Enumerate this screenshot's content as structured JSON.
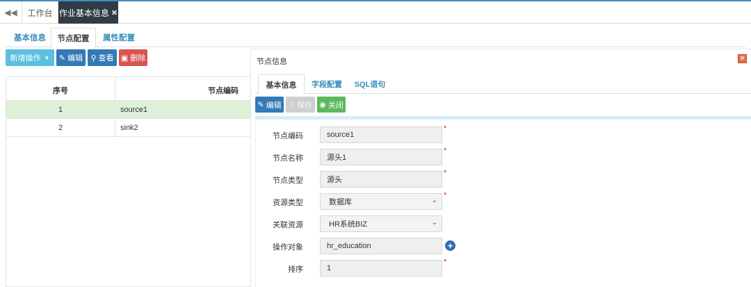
{
  "topbar": {
    "tabs": [
      {
        "label": "工作台"
      },
      {
        "label": "作业基本信息"
      }
    ]
  },
  "subnav": {
    "tabs": [
      {
        "label": "基本信息"
      },
      {
        "label": "节点配置"
      },
      {
        "label": "属性配置"
      }
    ],
    "active": "节点配置"
  },
  "toolbar": {
    "add_label": "新增操作",
    "edit_label": "编辑",
    "view_label": "查看",
    "delete_label": "删除"
  },
  "node_table": {
    "columns": [
      "序号",
      "节点编码"
    ],
    "rows": [
      {
        "index": "1",
        "code": "source1",
        "selected": true
      },
      {
        "index": "2",
        "code": "sink2",
        "selected": false
      }
    ]
  },
  "panel": {
    "title": "节点信息",
    "tabs": [
      {
        "label": "基本信息"
      },
      {
        "label": "字段配置"
      },
      {
        "label": "SQL语句"
      }
    ],
    "buttons": {
      "edit": "编辑",
      "save": "保存",
      "close": "关闭"
    },
    "form": {
      "node_code": {
        "label": "节点编码",
        "value": "source1",
        "required": true
      },
      "node_name": {
        "label": "节点名称",
        "value": "源头1",
        "required": true
      },
      "node_type": {
        "label": "节点类型",
        "value": "源头",
        "required": true
      },
      "resource_type": {
        "label": "资源类型",
        "value": "数据库",
        "required": true
      },
      "linked_resource": {
        "label": "关联资源",
        "value": "HR系统BIZ",
        "required": false
      },
      "operation_target": {
        "label": "操作对象",
        "value": "hr_education",
        "required": false
      },
      "sort": {
        "label": "排序",
        "value": "1",
        "required": true
      }
    }
  },
  "icons": {
    "back": "double-chevron-left-icon",
    "tab_close": "close-icon",
    "edit": "edit-icon",
    "view": "search-icon",
    "delete": "trash-icon",
    "save": "upload-icon",
    "close": "circle-dot-icon",
    "add": "plus-circle-icon"
  },
  "colors": {
    "primary": "#337ab7",
    "info": "#5bc0de",
    "danger": "#d9534f",
    "success": "#5cb85c",
    "selected_row": "#dff0d8",
    "active_tab": "#2f3b45",
    "required": "#e02020"
  }
}
